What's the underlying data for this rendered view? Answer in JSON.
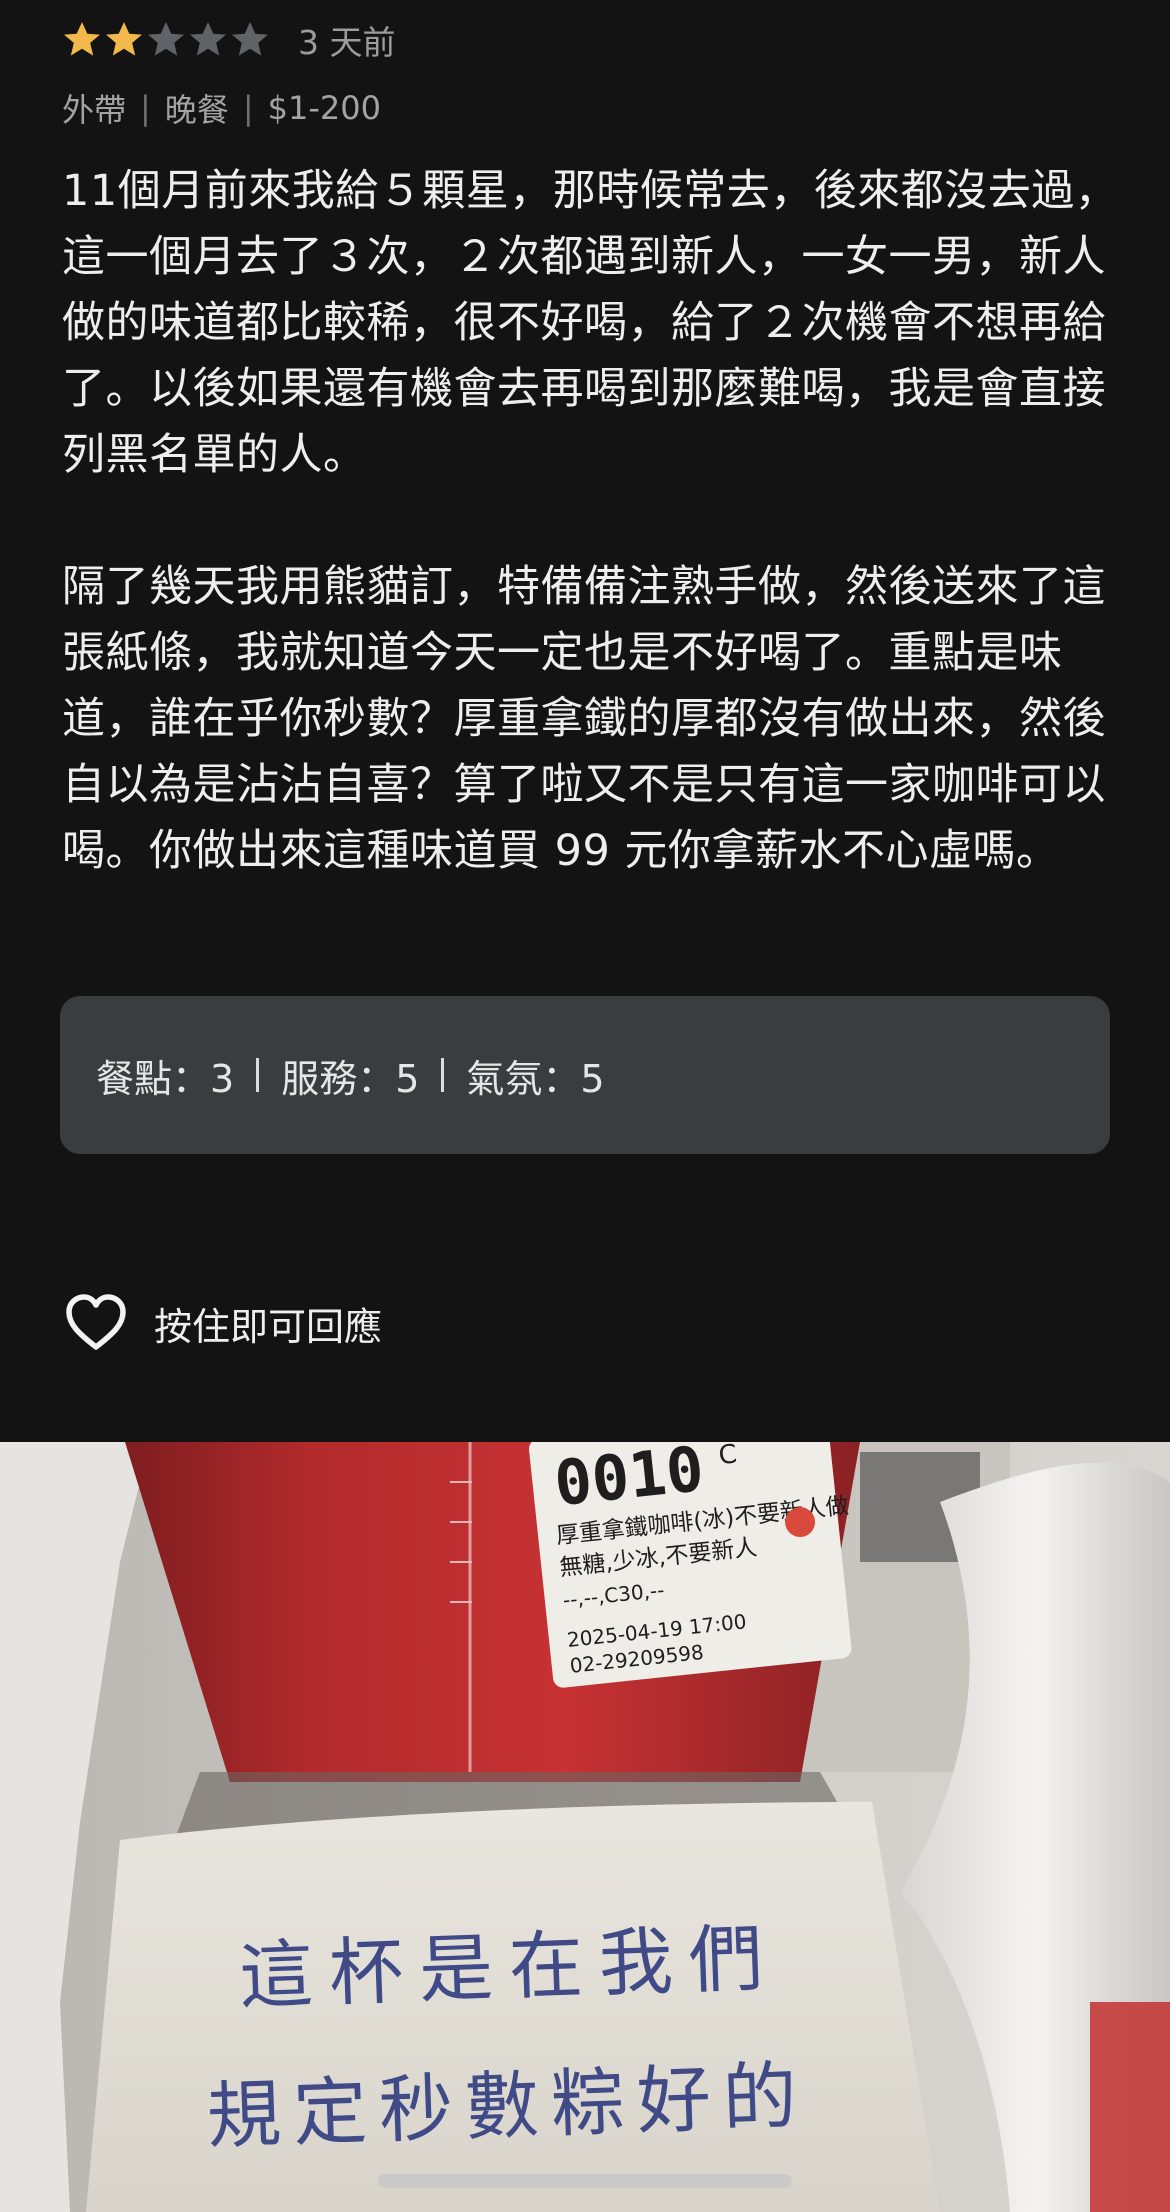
{
  "review": {
    "rating": 2,
    "rating_max": 5,
    "star_color": "#f2b84b",
    "star_empty_color": "#5f6266",
    "time_ago": "3 天前",
    "meta": [
      "外帶",
      "晚餐",
      "$1-200"
    ],
    "paragraphs": [
      "11個月前來我給５顆星，那時候常去，後來都沒去過，這一個月去了３次，２次都遇到新人，一女一男，新人做的味道都比較稀，很不好喝，給了２次機會不想再給了。以後如果還有機會去再喝到那麼難喝，我是會直接列黑名單的人。",
      "隔了幾天我用熊貓訂，特備備注熟手做，然後送來了這張紙條，我就知道今天一定也是不好喝了。重點是味道，誰在乎你秒數？厚重拿鐵的厚都沒有做出來，然後自以為是沾沾自喜？算了啦又不是只有這一家咖啡可以喝。你做出來這種味道買 99 元你拿薪水不心虛嗎。"
    ],
    "ratings": [
      {
        "label": "餐點：3"
      },
      {
        "label": "服務：5"
      },
      {
        "label": "氣氛：5"
      }
    ],
    "react_label": "按住即可回應"
  },
  "photo": {
    "cup_label": {
      "order_no": "0010",
      "order_suffix": "C",
      "item": "厚重拿鐵咖啡(冰)不要新人做",
      "options": "無糖,少冰,不要新人",
      "extra": "--,--,C30,--",
      "datetime": "2025-04-19 17:00",
      "phone": "02-29209598"
    },
    "note_line_1": "這杯是在我們",
    "note_line_2": "規定秒數粽好的"
  }
}
